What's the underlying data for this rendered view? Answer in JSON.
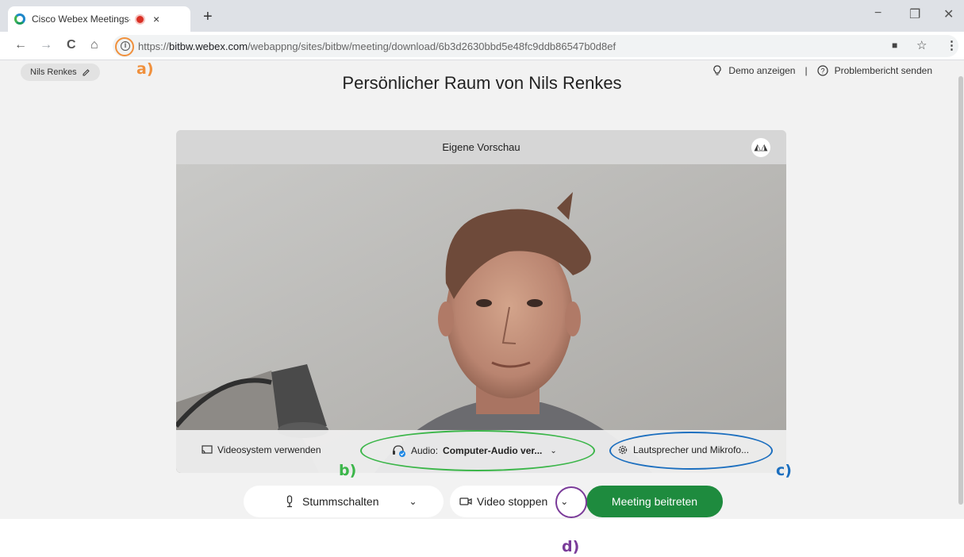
{
  "browser": {
    "tab_title": "Cisco Webex Meetings-Web",
    "tab_close": "×",
    "new_tab": "+",
    "minimize": "−",
    "restore": "❐",
    "close": "✕",
    "url_scheme": "https://",
    "url_host": "bitbw.webex.com",
    "url_path": "/webappng/sites/bitbw/meeting/download/6b3d2630bbd5e48fc9ddb86547b0d8ef",
    "back": "←",
    "forward": "→",
    "reload": "C",
    "home": "⌂",
    "star": "☆",
    "menu": "⋮"
  },
  "page": {
    "user_chip": "Nils Renkes",
    "title": "Persönlicher Raum von Nils Renkes",
    "demo_link": "Demo anzeigen",
    "separator": "|",
    "report_link": "Problembericht senden"
  },
  "preview": {
    "header": "Eigene Vorschau",
    "video_system": "Videosystem verwenden",
    "audio_label": "Audio:",
    "audio_value": "Computer-Audio ver...",
    "speaker_mic": "Lautsprecher und Mikrofo..."
  },
  "controls": {
    "mute": "Stummschalten",
    "video_stop": "Video stoppen",
    "join": "Meeting beitreten"
  },
  "annotations": {
    "a": "a)",
    "b": "b)",
    "c": "c)",
    "d": "d)",
    "colors": {
      "a": "#f0903c",
      "b": "#3cb64a",
      "c": "#1c6fbf",
      "d": "#7a3b99"
    }
  }
}
